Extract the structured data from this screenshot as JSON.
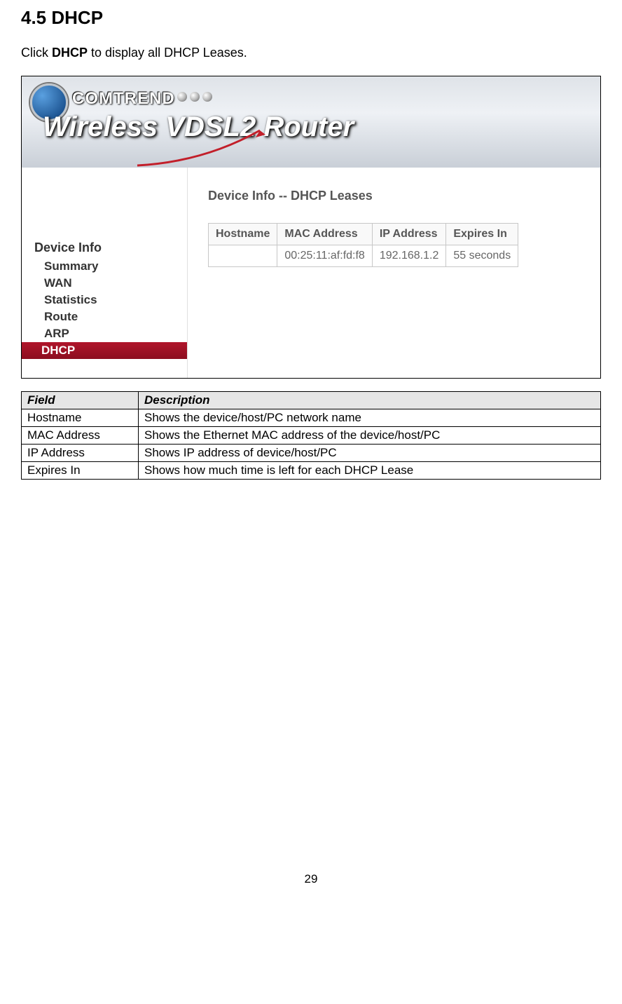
{
  "section": {
    "title": "4.5 DHCP",
    "intro_prefix": "Click ",
    "intro_bold": "DHCP",
    "intro_suffix": " to display all DHCP Leases."
  },
  "banner": {
    "brand": "COMTREND",
    "product": "Wireless VDSL2 Router"
  },
  "sidebar": {
    "heading": "Device Info",
    "items": [
      {
        "label": "Summary",
        "active": false
      },
      {
        "label": "WAN",
        "active": false
      },
      {
        "label": "Statistics",
        "active": false
      },
      {
        "label": "Route",
        "active": false
      },
      {
        "label": "ARP",
        "active": false
      },
      {
        "label": "DHCP",
        "active": true
      }
    ]
  },
  "content": {
    "title": "Device Info -- DHCP Leases",
    "columns": [
      "Hostname",
      "MAC Address",
      "IP Address",
      "Expires In"
    ],
    "rows": [
      {
        "hostname": "",
        "mac": "00:25:11:af:fd:f8",
        "ip": "192.168.1.2",
        "expires": "55 seconds"
      }
    ]
  },
  "fields_table": {
    "headers": [
      "Field",
      "Description"
    ],
    "rows": [
      {
        "field": "Hostname",
        "desc": "Shows the device/host/PC network name"
      },
      {
        "field": "MAC Address",
        "desc": "Shows the Ethernet MAC address of the device/host/PC"
      },
      {
        "field": "IP Address",
        "desc": "Shows IP address of device/host/PC"
      },
      {
        "field": "Expires In",
        "desc": "Shows how much time is left for each DHCP Lease"
      }
    ]
  },
  "page_number": "29"
}
